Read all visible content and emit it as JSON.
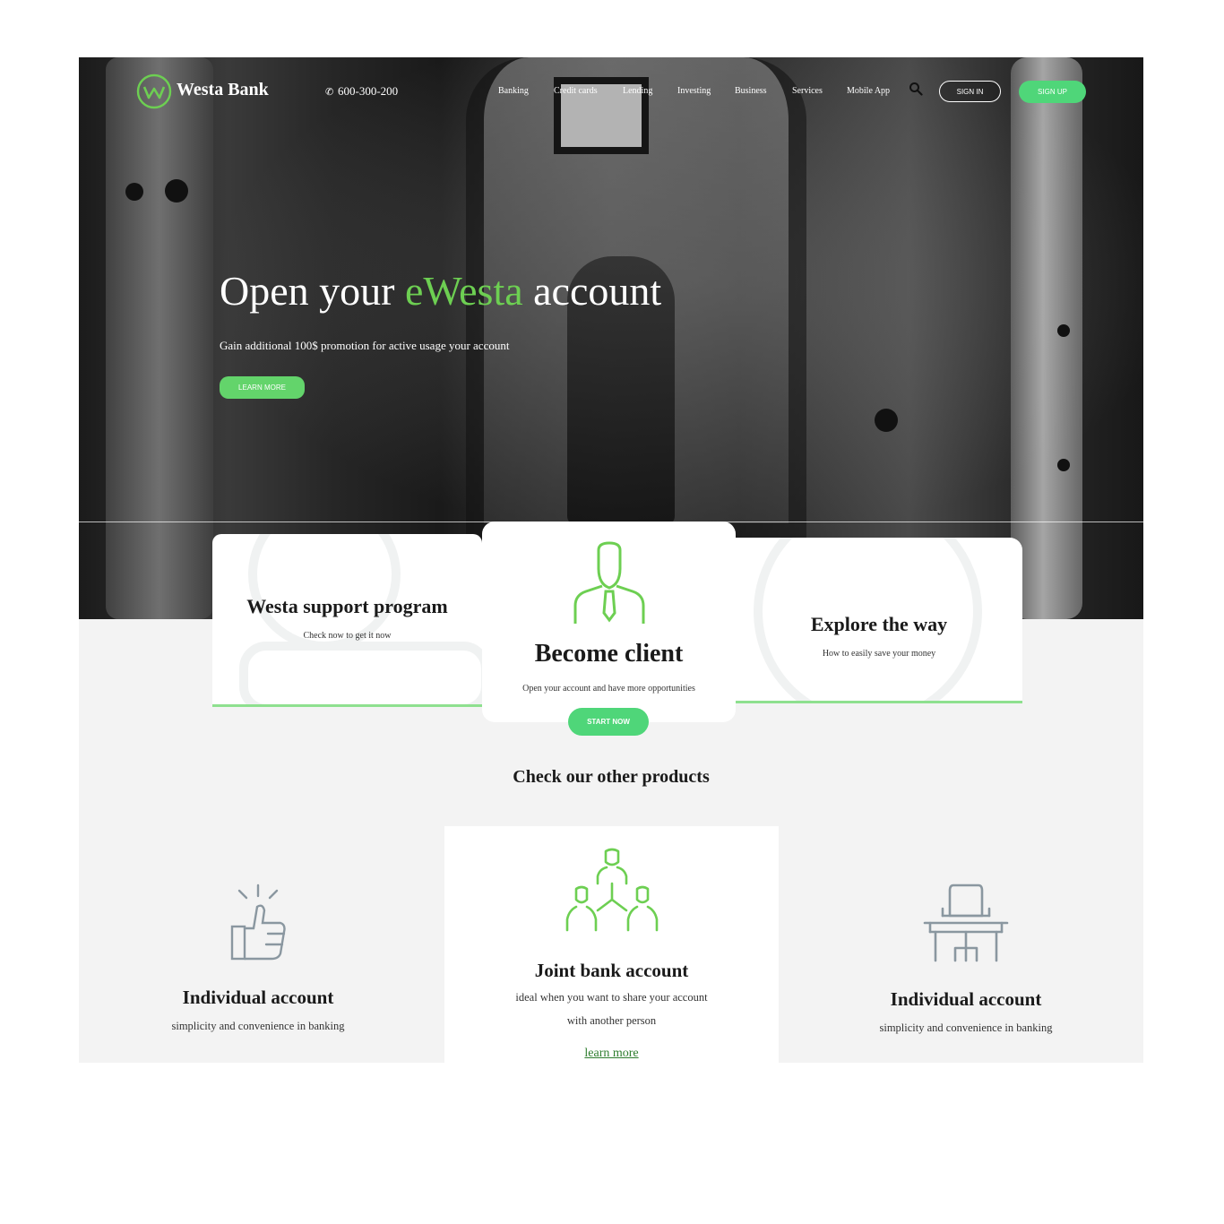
{
  "brand": {
    "name": "Westa Bank",
    "logo_icon": "w-circle-logo-icon",
    "accent": "#6dcf52"
  },
  "header": {
    "phone": "600-300-200",
    "nav": [
      "Banking",
      "Credit cards",
      "Lending",
      "Investing",
      "Business",
      "Services",
      "Mobile App"
    ],
    "sign_in": "SIGN IN",
    "sign_up": "SIGN UP"
  },
  "hero": {
    "title_pre": "Open your ",
    "title_accent": "eWesta",
    "title_post": " account",
    "subtitle": "Gain additional 100$ promotion for active usage your account",
    "cta": "LEARN MORE"
  },
  "features": [
    {
      "title": "Westa support program",
      "desc": "Check now to get it now"
    },
    {
      "title": "Become client",
      "desc": "Open your account and have more opportunities",
      "cta": "START NOW"
    },
    {
      "title": "Explore the way",
      "desc": "How to easily save your money"
    }
  ],
  "products": {
    "heading": "Check our other products",
    "items": [
      {
        "title": "Individual account",
        "desc": "simplicity and convenience in banking",
        "icon": "thumbs-up-icon"
      },
      {
        "title": "Joint bank account",
        "desc_line1": "ideal when you want to share your account",
        "desc_line2": "with another person",
        "link": "learn more",
        "icon": "group-network-icon"
      },
      {
        "title": "Individual account",
        "desc": "simplicity and convenience in banking",
        "icon": "desk-chair-icon"
      }
    ]
  },
  "colors": {
    "green": "#4fd679",
    "bar_green": "#8ee08f",
    "icon_gray": "#8a97a0"
  }
}
